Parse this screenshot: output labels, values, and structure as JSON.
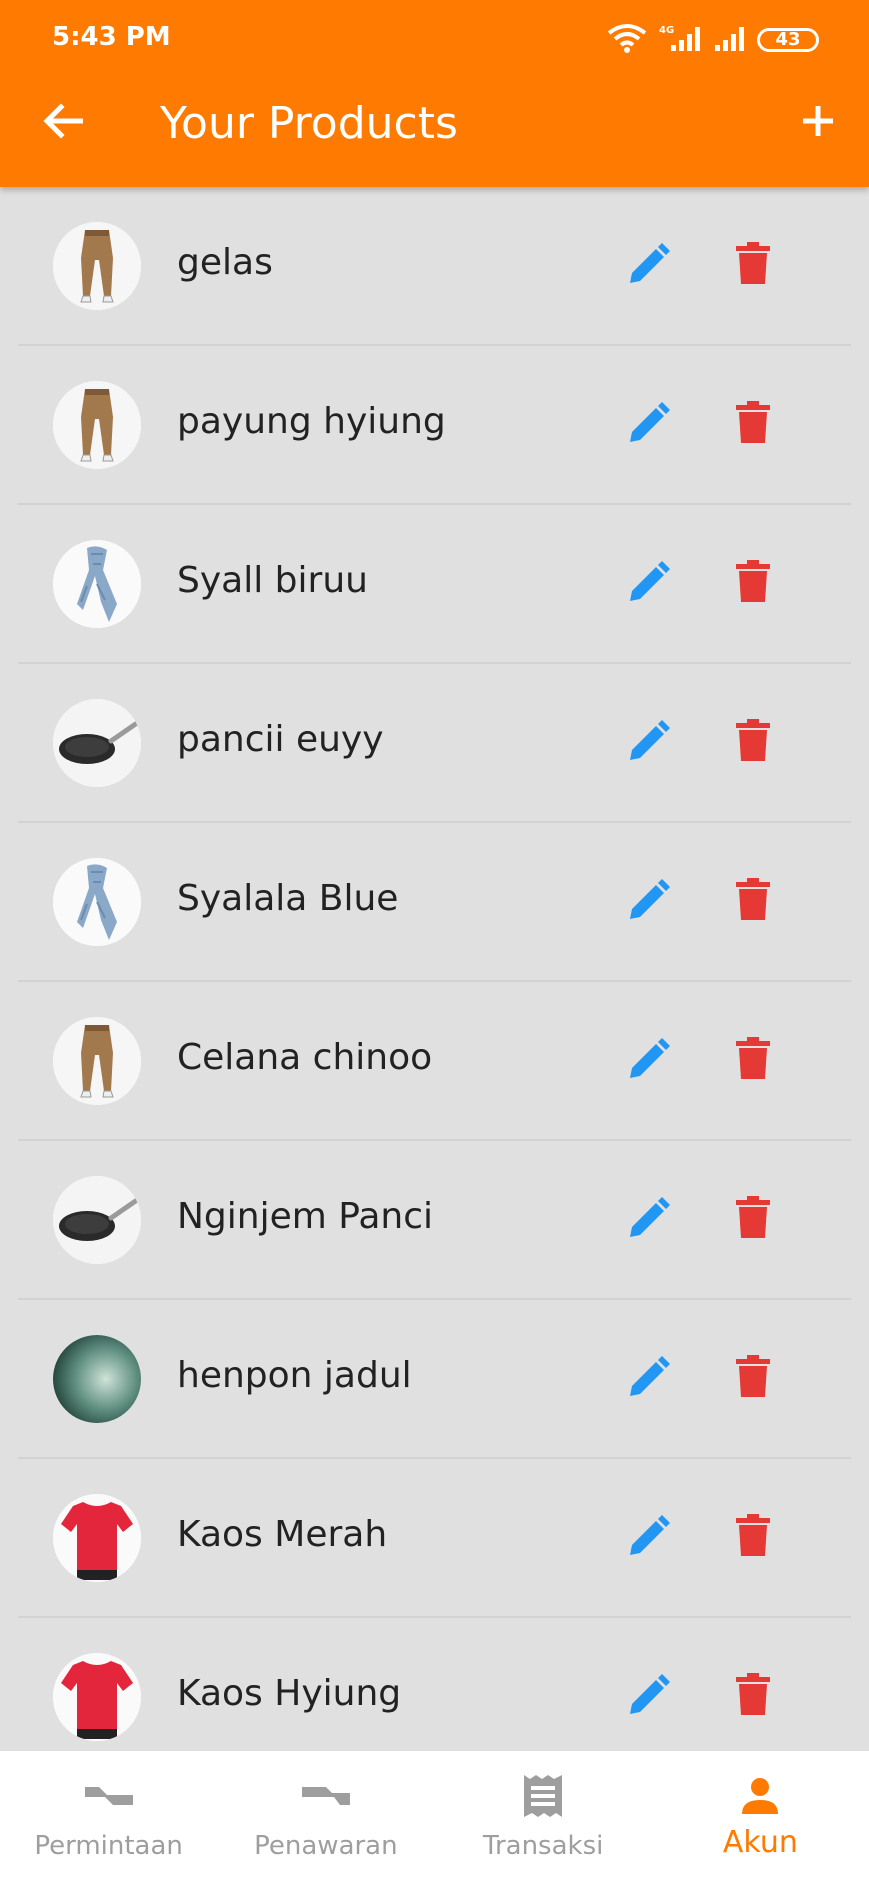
{
  "status_bar": {
    "time": "5:43 PM",
    "network": "4G",
    "battery": "43"
  },
  "app_bar": {
    "title": "Your Products",
    "back_icon": "arrow-back-icon",
    "add_icon": "add-icon",
    "color": "#ff7a00"
  },
  "products": [
    {
      "name": "gelas",
      "image": "pants"
    },
    {
      "name": "payung hyiung",
      "image": "pants"
    },
    {
      "name": "Syall biruu",
      "image": "scarf"
    },
    {
      "name": "pancii euyy",
      "image": "pan"
    },
    {
      "name": "Syalala Blue",
      "image": "scarf"
    },
    {
      "name": "Celana chinoo",
      "image": "pants"
    },
    {
      "name": "Nginjem Panci",
      "image": "pan"
    },
    {
      "name": "henpon jadul",
      "image": "green"
    },
    {
      "name": "Kaos Merah",
      "image": "tshirt"
    },
    {
      "name": "Kaos Hyiung",
      "image": "tshirt"
    }
  ],
  "actions": {
    "edit_icon": "pencil-icon",
    "delete_icon": "trash-icon",
    "edit_color": "#2196f3",
    "delete_color": "#e53935"
  },
  "bottom_nav": {
    "items": [
      {
        "label": "Permintaan",
        "icon": "handshake-request-icon",
        "active": false
      },
      {
        "label": "Penawaran",
        "icon": "handshake-offer-icon",
        "active": false
      },
      {
        "label": "Transaksi",
        "icon": "receipt-icon",
        "active": false
      },
      {
        "label": "Akun",
        "icon": "person-icon",
        "active": true
      }
    ],
    "active_color": "#ff7a00",
    "inactive_color": "#9e9e9e"
  }
}
